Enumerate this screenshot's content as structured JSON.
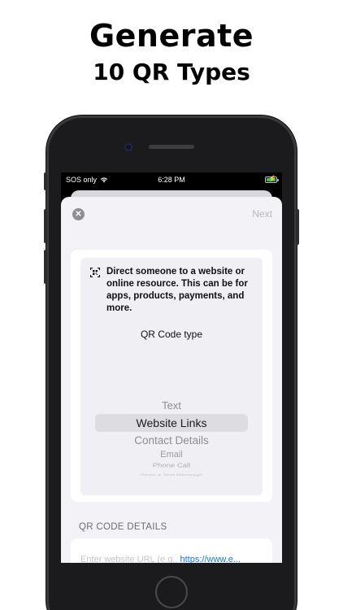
{
  "promo": {
    "headline": "Generate",
    "subline": "10 QR Types"
  },
  "status_bar": {
    "carrier": "SOS only",
    "time": "6:28 PM",
    "battery_level": 1.0,
    "charging": true,
    "colors": {
      "battery": "#34c759"
    }
  },
  "sheet": {
    "close_icon": "close-icon",
    "next_label": "Next",
    "description": "Direct someone to a website or online resource. This can be for apps, products, payments, and more.",
    "qr_type_label": "QR Code type",
    "picker": {
      "items": [
        "Text",
        "Website Links",
        "Contact Details",
        "Email",
        "Phone Call",
        "Send a Text Message"
      ],
      "selected": "Website Links"
    },
    "details_header": "QR CODE DETAILS",
    "url_field": {
      "placeholder": "Enter website URL (e.g., ",
      "example": "https://www.e..."
    }
  },
  "colors": {
    "sheet_bg": "#f2f2f7",
    "link": "#1a73e8",
    "disabled": "#b8b8bd"
  }
}
